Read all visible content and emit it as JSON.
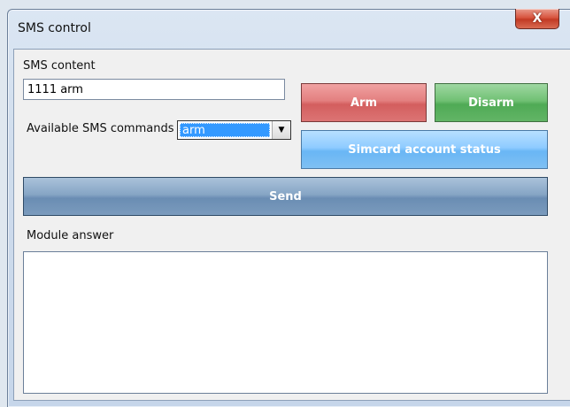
{
  "window": {
    "title": "SMS control",
    "close_glyph": "X"
  },
  "sms": {
    "content_label": "SMS content",
    "content_value": "1111 arm",
    "commands_label": "Available SMS commands",
    "commands_selected": "arm"
  },
  "buttons": {
    "arm": "Arm",
    "disarm": "Disarm",
    "simcard_status": "Simcard account status",
    "send": "Send"
  },
  "answer": {
    "label": "Module answer",
    "value": ""
  },
  "colors": {
    "arm": "#e37f7f",
    "disarm": "#70c073",
    "simcard": "#8ecbff",
    "send": "#86a5c5",
    "selection": "#3399ff"
  },
  "icons": {
    "close": "close-icon",
    "dropdown": "chevron-down-icon"
  }
}
